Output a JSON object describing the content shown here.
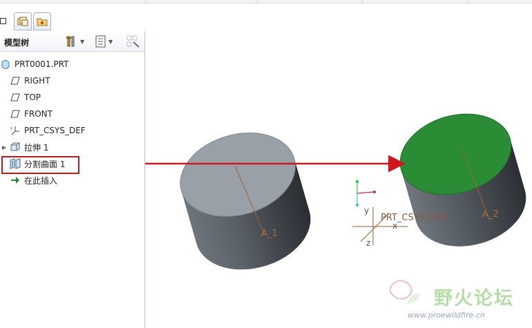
{
  "model_tree": {
    "header_title": "模型树",
    "tool_icons": [
      "settings-icon",
      "tree-filter-icon",
      "columns-icon"
    ],
    "items": [
      {
        "label": "PRT0001.PRT",
        "icon": "part-icon"
      },
      {
        "label": "RIGHT",
        "icon": "datum-plane-icon"
      },
      {
        "label": "TOP",
        "icon": "datum-plane-icon"
      },
      {
        "label": "FRONT",
        "icon": "datum-plane-icon"
      },
      {
        "label": "PRT_CSYS_DEF",
        "icon": "csys-icon"
      },
      {
        "label": "拉伸 1",
        "icon": "extrude-icon"
      },
      {
        "label": "分割曲面 1",
        "icon": "split-surface-icon"
      },
      {
        "label": "在此插入",
        "icon": "insert-here-arrow-icon"
      }
    ]
  },
  "viewport": {
    "axis_left": "A_1",
    "axis_right": "A_2",
    "csys_label": "PRT_CSYS_DEF",
    "csys_axes": {
      "x": "x",
      "y": "y",
      "z": "z"
    },
    "highlight_color": "#c8161d",
    "surface_green": "#2a8c34"
  },
  "watermark": {
    "text": "野火论坛",
    "url": "www.proewildfire.cn"
  }
}
